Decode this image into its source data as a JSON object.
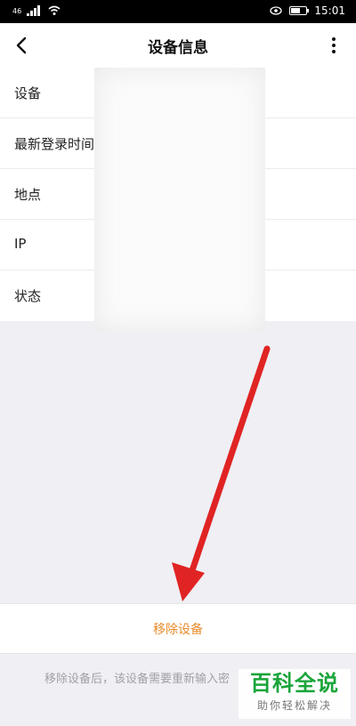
{
  "status_bar": {
    "signal_left": "46",
    "time": "15:01",
    "battery_level_percent": 60
  },
  "nav": {
    "title": "设备信息",
    "back_icon": "chevron-left-icon",
    "more_icon": "more-vertical-icon"
  },
  "info": {
    "rows": [
      {
        "label": "设备"
      },
      {
        "label": "最新登录时间"
      },
      {
        "label": "地点"
      },
      {
        "label": "IP"
      },
      {
        "label": "状态"
      }
    ]
  },
  "actions": {
    "remove_label": "移除设备"
  },
  "hint": "移除设备后，该设备需要重新输入密",
  "watermark": {
    "main": "百科全说",
    "sub": "助你轻松解决"
  },
  "colors": {
    "accent_orange": "#e98b2a",
    "annotation_arrow": "#e02424",
    "watermark_green": "#1aa53a"
  }
}
